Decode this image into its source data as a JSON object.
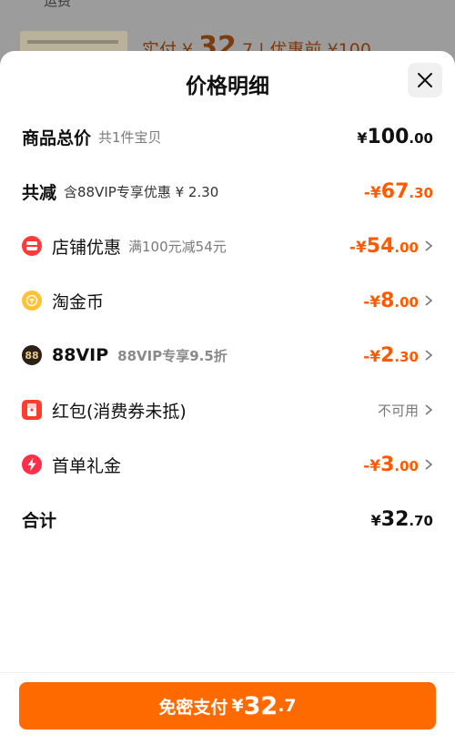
{
  "background": {
    "top_text": "运费",
    "price_text": "实付 ¥ ",
    "price_int": "32",
    "price_dec": ".7",
    "orig_text": " | 优惠前 ¥100"
  },
  "sheet": {
    "title": "价格明细",
    "close_icon": "close-icon"
  },
  "rows": {
    "total_goods": {
      "label": "商品总价",
      "sub": "共1件宝贝",
      "pre": "¥",
      "int": "100",
      "dec": ".00"
    },
    "total_discount": {
      "label": "共减",
      "sub": "含88VIP专享优惠 ¥ 2.30",
      "pre": "-¥",
      "int": "67",
      "dec": ".30"
    },
    "shop_discount": {
      "label": "店铺优惠",
      "sub": "满100元减54元",
      "pre": "-¥",
      "int": "54",
      "dec": ".00",
      "icon": "shop-icon"
    },
    "tao_coin": {
      "label": "淘金币",
      "pre": "-¥",
      "int": "8",
      "dec": ".00",
      "icon": "coin-icon"
    },
    "vip88": {
      "label": "88VIP",
      "sub": "88VIP专享9.5折",
      "pre": "-¥",
      "int": "2",
      "dec": ".30",
      "icon_text": "88"
    },
    "red_packet": {
      "label": "红包(消费券未抵)",
      "status": "不可用",
      "icon": "red-packet-icon"
    },
    "first_order": {
      "label": "首单礼金",
      "pre": "-¥",
      "int": "3",
      "dec": ".00",
      "icon": "lightning-icon"
    },
    "sum": {
      "label": "合计",
      "pre": "¥",
      "int": "32",
      "dec": ".70"
    }
  },
  "pay": {
    "label": "免密支付",
    "pre": "¥",
    "int": "32",
    "dec": ".7"
  },
  "colors": {
    "accent": "#ff6a00",
    "discount": "#ff5a00"
  }
}
